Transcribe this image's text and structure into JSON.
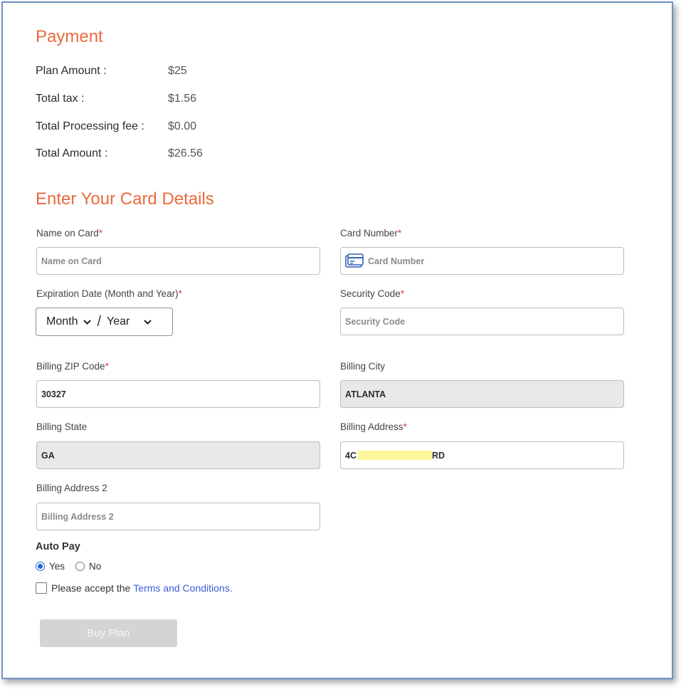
{
  "colors": {
    "accent": "#ea6a3e",
    "link": "#3b5bd6",
    "required": "#e33b3b",
    "frame": "#6f8fc9"
  },
  "payment": {
    "title": "Payment",
    "rows": [
      {
        "label": "Plan Amount :",
        "value": "$25"
      },
      {
        "label": "Total tax :",
        "value": "$1.56"
      },
      {
        "label": "Total Processing fee :",
        "value": "$0.00"
      },
      {
        "label": "Total Amount :",
        "value": "$26.56"
      }
    ]
  },
  "card": {
    "title": "Enter Your Card Details",
    "name_label": "Name on Card",
    "name_placeholder": "Name on Card",
    "number_label": "Card Number",
    "number_placeholder": "Card Number",
    "expiry_label": "Expiration Date (Month and Year)",
    "month": "Month",
    "separator": "/",
    "year": "Year",
    "security_label": "Security Code",
    "security_placeholder": "Security Code",
    "zip_label": "Billing ZIP Code",
    "zip_value": "30327",
    "city_label": "Billing City",
    "city_value": "ATLANTA",
    "state_label": "Billing State",
    "state_value": "GA",
    "address_label": "Billing Address",
    "address_prefix": "4C",
    "address_suffix": "RD",
    "address2_label": "Billing Address 2",
    "address2_placeholder": "Billing Address 2",
    "required_mark": "*"
  },
  "autopay": {
    "title": "Auto Pay",
    "yes": "Yes",
    "no": "No",
    "selected": "Yes"
  },
  "terms": {
    "text": "Please accept the",
    "link": "Terms and Conditions."
  },
  "buy_label": "Buy Plan",
  "icons": {
    "card": "credit-card-icon",
    "chevron": "chevron-down-icon"
  }
}
